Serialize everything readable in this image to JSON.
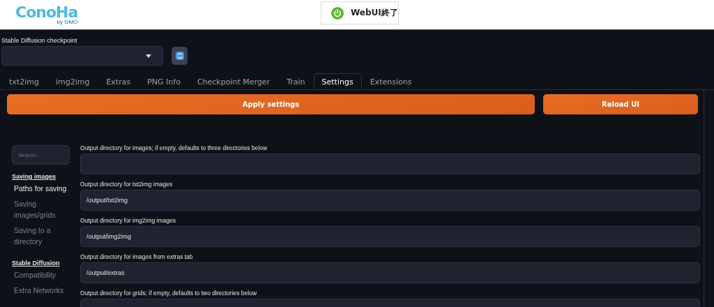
{
  "header": {
    "logo": {
      "name": "ConoHa",
      "by": "by GMO"
    },
    "shutdown_button": "WebUI終了"
  },
  "checkpoint": {
    "label": "Stable Diffusion checkpoint"
  },
  "tabs": [
    {
      "label": "txt2img",
      "selected": false
    },
    {
      "label": "img2img",
      "selected": false
    },
    {
      "label": "Extras",
      "selected": false
    },
    {
      "label": "PNG Info",
      "selected": false
    },
    {
      "label": "Checkpoint Merger",
      "selected": false
    },
    {
      "label": "Train",
      "selected": false
    },
    {
      "label": "Settings",
      "selected": true
    },
    {
      "label": "Extensions",
      "selected": false
    }
  ],
  "buttons": {
    "apply": "Apply settings",
    "reload": "Reload UI"
  },
  "sidebar": {
    "search": {
      "placeholder": "Search..."
    },
    "sections": [
      {
        "title": "Saving images",
        "children": [
          {
            "label": "Paths for saving",
            "selected": true
          },
          {
            "label": "Saving images/grids",
            "selected": false
          },
          {
            "label": "Saving to a directory",
            "selected": false
          }
        ]
      },
      {
        "title": "Stable Diffusion",
        "children": [
          {
            "label": "Compatibility",
            "selected": false
          },
          {
            "label": "Extra Networks",
            "selected": false
          }
        ]
      }
    ]
  },
  "settings": [
    {
      "label": "Output directory for images; if empty, defaults to three directories below"
    },
    {
      "label": "Output directory for txt2img images",
      "value": "/output/txt2img"
    },
    {
      "label": "Output directory for img2img images",
      "value": "/output/img2img"
    },
    {
      "label": "Output directory for images from extras tab",
      "value": "/output/extras"
    },
    {
      "label": "Output directory for grids; if empty, defaults to two directories below"
    }
  ]
}
